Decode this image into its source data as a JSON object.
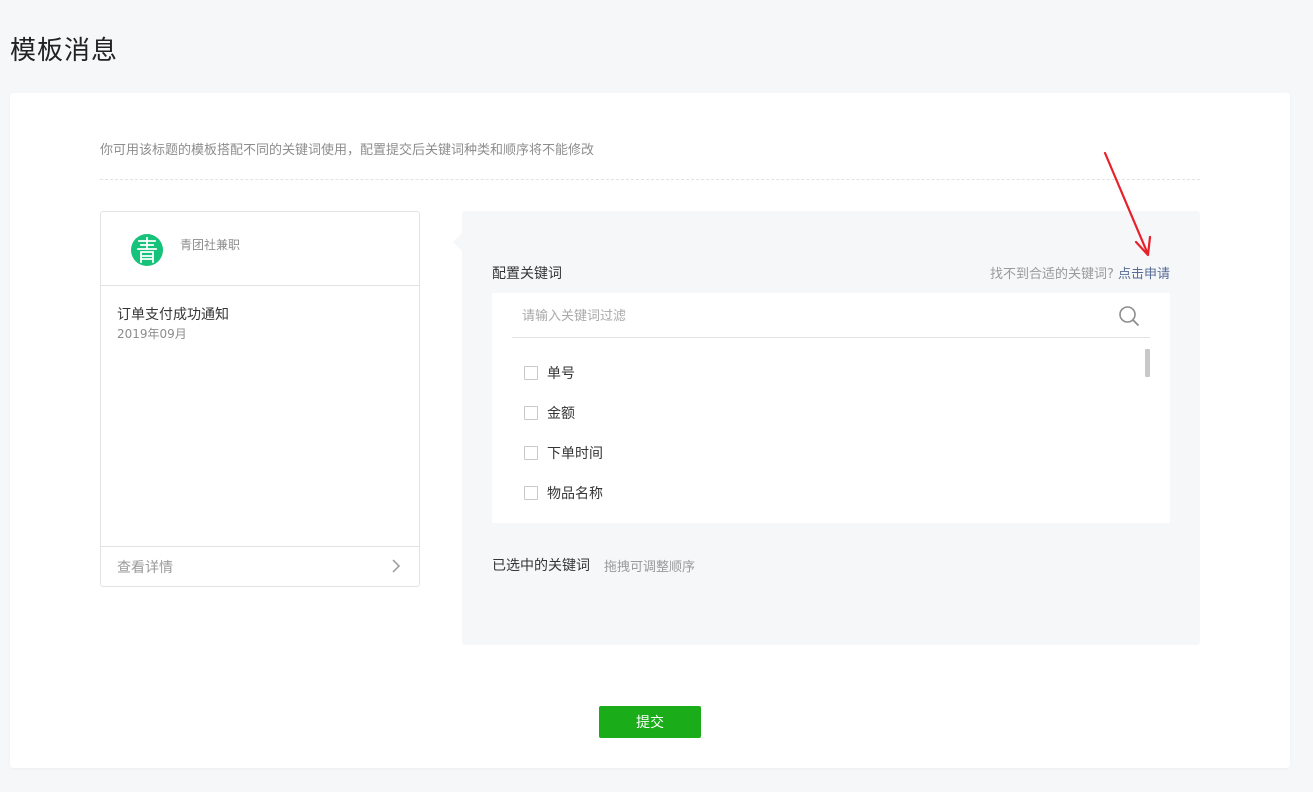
{
  "page": {
    "title": "模板消息"
  },
  "tip": "你可用该标题的模板搭配不同的关键词使用，配置提交后关键词种类和顺序将不能修改",
  "preview": {
    "account_name": "青团社兼职",
    "avatar_char": "青",
    "template_title": "订单支付成功通知",
    "template_date": "2019年09月",
    "detail_link": "查看详情"
  },
  "config": {
    "label": "配置关键词",
    "hint_prefix": "找不到合适的关键词?",
    "hint_link": "点击申请",
    "search_placeholder": "请输入关键词过滤",
    "keywords": [
      {
        "label": "单号",
        "checked": false
      },
      {
        "label": "金额",
        "checked": false
      },
      {
        "label": "下单时间",
        "checked": false
      },
      {
        "label": "物品名称",
        "checked": false
      }
    ],
    "selected_label": "已选中的关键词",
    "selected_hint": "拖拽可调整顺序"
  },
  "submit_label": "提交",
  "colors": {
    "primary_green": "#1aad19",
    "avatar_green": "#17c27a",
    "link_blue": "#576b95",
    "annotation_red": "#e8202a"
  }
}
